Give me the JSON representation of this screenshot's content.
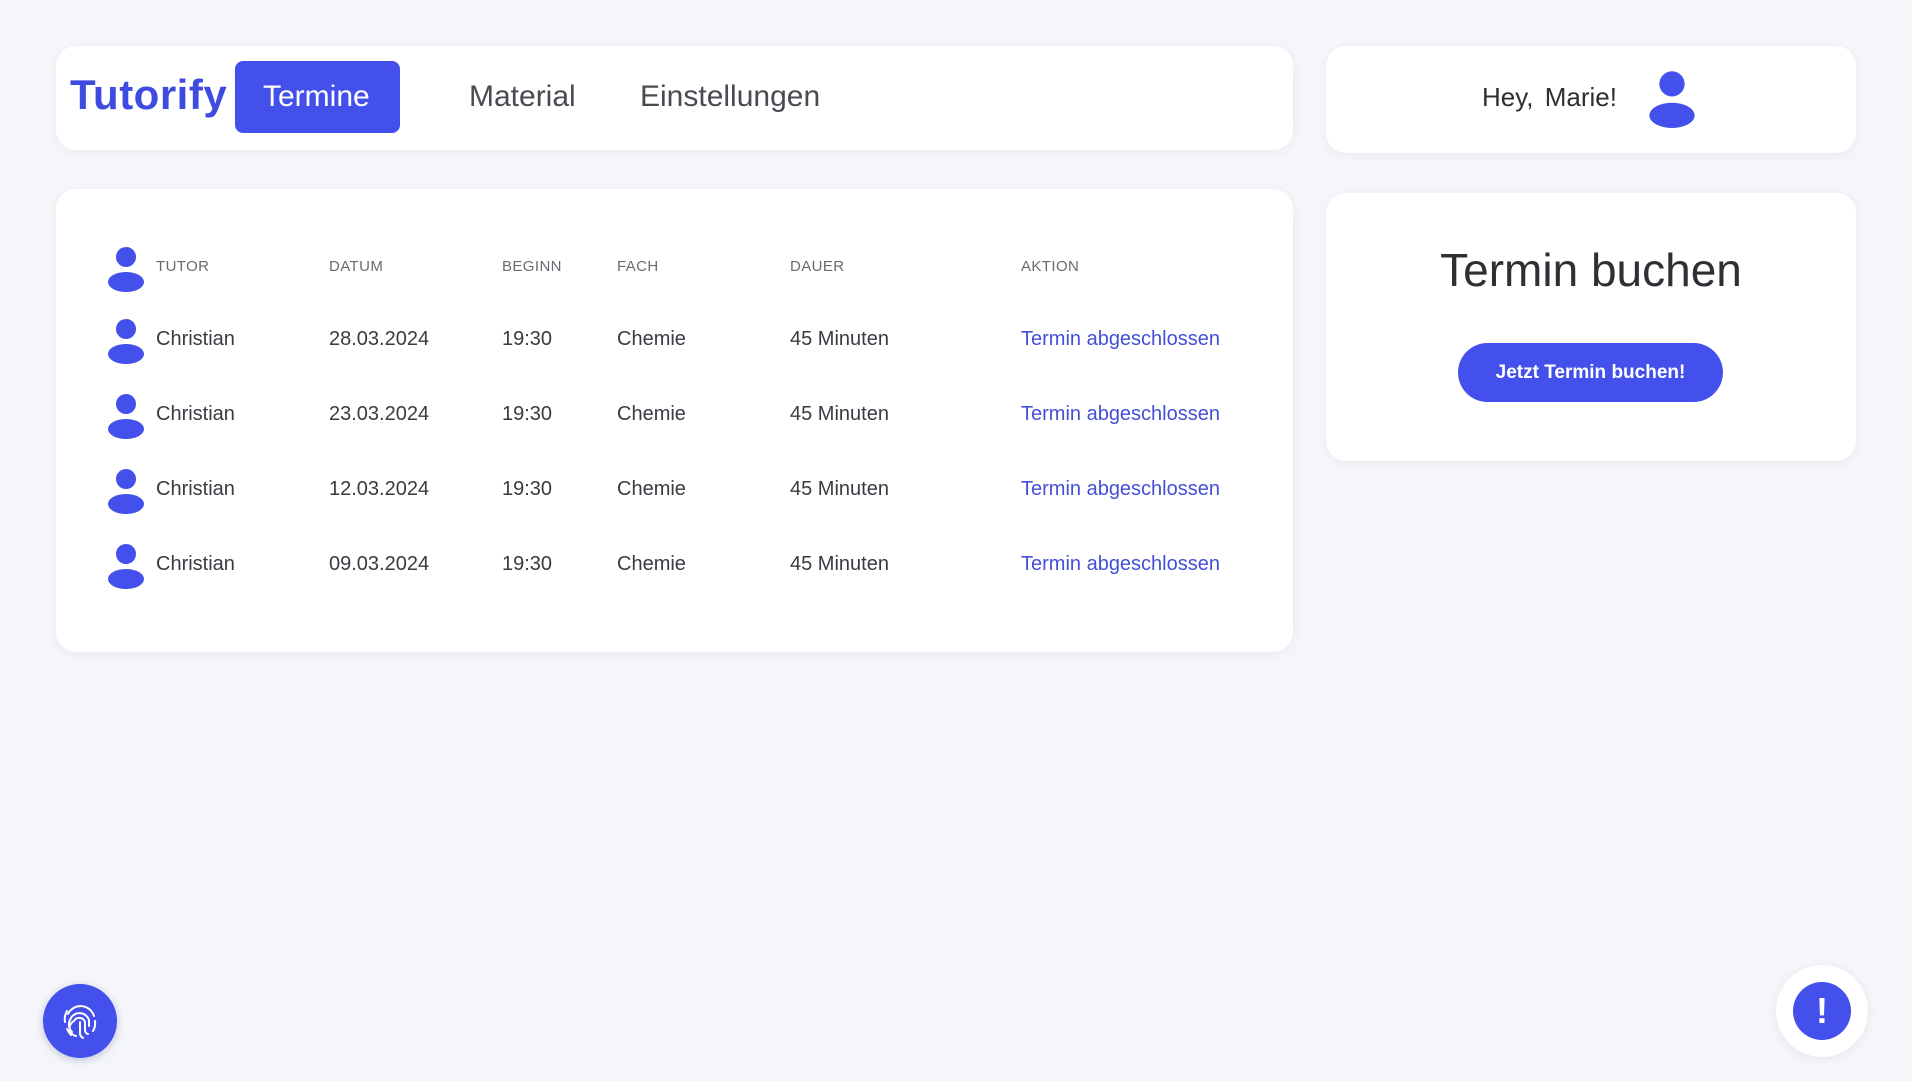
{
  "colors": {
    "accent": "#4450eb",
    "background": "#f4f6fa",
    "card": "#ffffff",
    "link": "#4350d6"
  },
  "nav": {
    "logo": "Tutorify",
    "tabs": [
      {
        "label": "Termine",
        "active": true
      },
      {
        "label": "Material",
        "active": false
      },
      {
        "label": "Einstellungen",
        "active": false
      }
    ]
  },
  "user": {
    "greeting": "Hey, Marie!",
    "avatar_icon": "user-icon"
  },
  "table": {
    "headers": {
      "tutor": "TUTOR",
      "datum": "DATUM",
      "beginn": "BEGINN",
      "fach": "FACH",
      "dauer": "DAUER",
      "aktion": "AKTION"
    },
    "rows": [
      {
        "tutor": "Christian",
        "datum": "28.03.2024",
        "beginn": "19:30",
        "fach": "Chemie",
        "dauer": "45 Minuten",
        "aktion": "Termin abgeschlossen"
      },
      {
        "tutor": "Christian",
        "datum": "23.03.2024",
        "beginn": "19:30",
        "fach": "Chemie",
        "dauer": "45 Minuten",
        "aktion": "Termin abgeschlossen"
      },
      {
        "tutor": "Christian",
        "datum": "12.03.2024",
        "beginn": "19:30",
        "fach": "Chemie",
        "dauer": "45 Minuten",
        "aktion": "Termin abgeschlossen"
      },
      {
        "tutor": "Christian",
        "datum": "09.03.2024",
        "beginn": "19:30",
        "fach": "Chemie",
        "dauer": "45 Minuten",
        "aktion": "Termin abgeschlossen"
      }
    ]
  },
  "booking": {
    "title": "Termin buchen",
    "button_label": "Jetzt Termin buchen!"
  },
  "floating": {
    "left_icon": "fingerprint-icon",
    "right_icon": "exclamation-icon",
    "right_glyph": "!"
  }
}
